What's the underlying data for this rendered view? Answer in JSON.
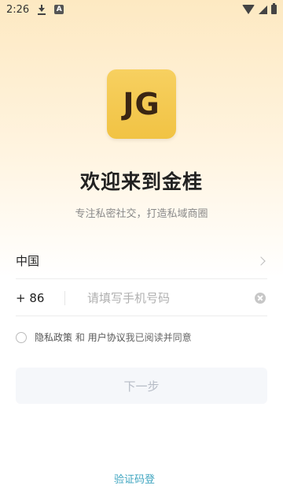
{
  "status_bar": {
    "time": "2:26",
    "a_badge": "A"
  },
  "logo": {
    "text": "JG"
  },
  "title": "欢迎来到金桂",
  "subtitle": "专注私密社交，打造私域商圈",
  "country": {
    "label": "中国"
  },
  "phone": {
    "dial_code": "+ 86",
    "placeholder": "请填写手机号码",
    "value": ""
  },
  "agreement": {
    "privacy": "隐私政策",
    "and": " 和 ",
    "user": "用户协议",
    "suffix": "我已阅读并同意"
  },
  "next_button": "下一步",
  "code_login": "验证码登",
  "colors": {
    "logo_bg": "#f3c84c",
    "accent_link": "#3fa5c0",
    "button_bg": "#f5f7fa"
  }
}
